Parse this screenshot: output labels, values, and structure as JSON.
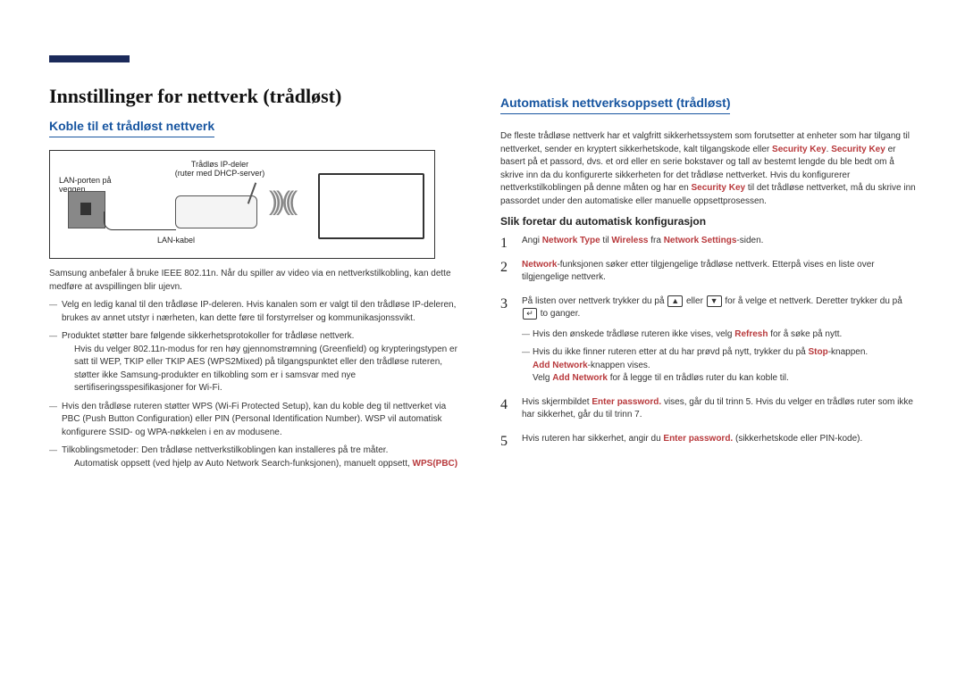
{
  "left": {
    "title": "Innstillinger for nettverk (trådløst)",
    "sub1": "Koble til et trådløst nettverk",
    "diagram": {
      "wall": "LAN-porten på veggen",
      "router1": "Trådløs IP-deler",
      "router2": "(ruter med DHCP-server)",
      "cable": "LAN-kabel"
    },
    "p1": "Samsung anbefaler å bruke IEEE 802.11n. Når du spiller av video via en nettverkstilkobling, kan dette medføre at avspillingen blir ujevn.",
    "b1": "Velg en ledig kanal til den trådløse IP-deleren. Hvis kanalen som er valgt til den trådløse IP-deleren, brukes av annet utstyr i nærheten, kan dette føre til forstyrrelser og kommunikasjonssvikt.",
    "b2": "Produktet støtter bare følgende sikkerhetsprotokoller for trådløse nettverk.",
    "b2sub": "Hvis du velger 802.11n-modus for ren høy gjennomstrømning (Greenfield) og krypteringstypen er satt til WEP, TKIP eller TKIP AES (WPS2Mixed) på tilgangspunktet eller den trådløse ruteren, støtter ikke Samsung-produkter en tilkobling som er i samsvar med nye sertifiseringsspesifikasjoner for Wi-Fi.",
    "b3": "Hvis den trådløse ruteren støtter WPS (Wi-Fi Protected Setup), kan du koble deg til nettverket via PBC (Push Button Configuration) eller PIN (Personal Identification Number). WSP vil automatisk konfigurere SSID- og WPA-nøkkelen i en av modusene.",
    "b4a": "Tilkoblingsmetoder: Den trådløse nettverkstilkoblingen kan installeres på tre måter.",
    "b4b_pre": "Automatisk oppsett (ved hjelp av Auto Network Search-funksjonen), manuelt oppsett, ",
    "b4b_red": "WPS(PBC)"
  },
  "right": {
    "sub2": "Automatisk nettverksoppsett (trådløst)",
    "intro_a": "De fleste trådløse nettverk har et valgfritt sikkerhetssystem som forutsetter at enheter som har tilgang til nettverket, sender en kryptert sikkerhetskode, kalt tilgangskode eller ",
    "intro_key1": "Security Key",
    "intro_b": ". ",
    "intro_key2": "Security Key",
    "intro_c": " er basert på et passord, dvs. et ord eller en serie bokstaver og tall av bestemt lengde du ble bedt om å skrive inn da du konfigurerte sikkerheten for det trådløse nettverket. Hvis du konfigurerer nettverkstilkoblingen på denne måten og har en ",
    "intro_key3": "Security Key",
    "intro_d": " til det trådløse nettverket, må du skrive inn passordet under den automatiske eller manuelle oppsettprosessen.",
    "h3": "Slik foretar du automatisk konfigurasjon",
    "s1_a": "Angi ",
    "s1_nt": "Network Type",
    "s1_b": " til ",
    "s1_w": "Wireless",
    "s1_c": " fra ",
    "s1_ns": "Network Settings",
    "s1_d": "-siden.",
    "s2_a": "",
    "s2_net": "Network",
    "s2_b": "-funksjonen søker etter tilgjengelige trådløse nettverk. Etterpå vises en liste over tilgjengelige nettverk.",
    "s3_a": "På listen over nettverk trykker du på ",
    "s3_b": " eller ",
    "s3_c": " for å velge et nettverk. Deretter trykker du på ",
    "s3_d": " to ganger.",
    "s3sub1_a": "Hvis den ønskede trådløse ruteren ikke vises, velg ",
    "s3sub1_ref": "Refresh",
    "s3sub1_b": " for å søke på nytt.",
    "s3sub2_a": "Hvis du ikke finner ruteren etter at du har prøvd på nytt, trykker du på ",
    "s3sub2_stop": "Stop",
    "s3sub2_b": "-knappen.",
    "s3sub2_c_pre": "",
    "s3sub2_an": "Add Network",
    "s3sub2_c": "-knappen vises.",
    "s3sub2_d_a": "Velg ",
    "s3sub2_d_an": "Add Network",
    "s3sub2_d_b": " for å legge til en trådløs ruter du kan koble til.",
    "s4_a": "Hvis skjermbildet ",
    "s4_ep": "Enter password.",
    "s4_b": " vises, går du til trinn 5. Hvis du velger en trådløs ruter som ikke har sikkerhet, går du til trinn 7.",
    "s5_a": "Hvis ruteren har sikkerhet, angir du ",
    "s5_ep": "Enter password.",
    "s5_b": " (sikkerhetskode eller PIN-kode)."
  }
}
